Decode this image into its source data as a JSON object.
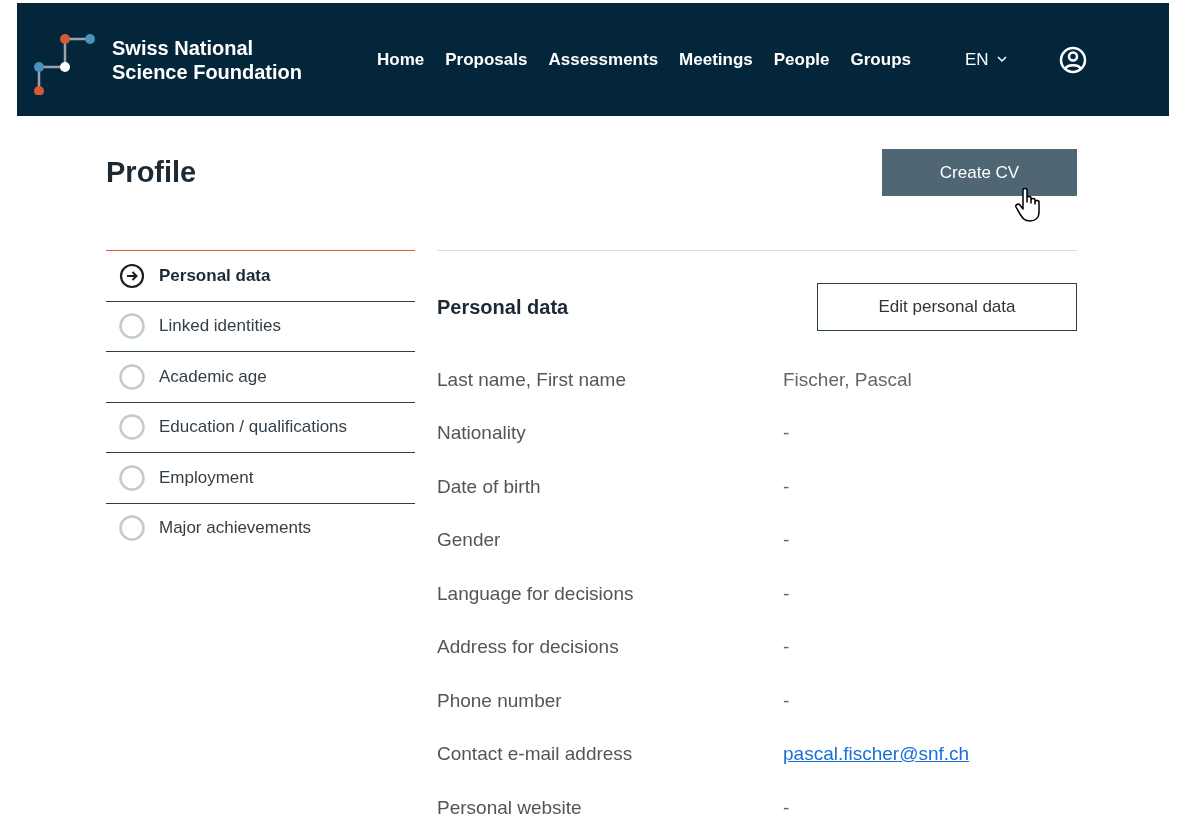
{
  "header": {
    "logo_text": [
      "Swiss National",
      "Science Foundation"
    ],
    "nav": [
      "Home",
      "Proposals",
      "Assessments",
      "Meetings",
      "People",
      "Groups"
    ],
    "language": "EN"
  },
  "page_title": "Profile",
  "create_cv_button": "Create CV",
  "sections": [
    {
      "label": "Personal data",
      "selected": true
    },
    {
      "label": "Linked identities",
      "selected": false
    },
    {
      "label": "Academic age",
      "selected": false
    },
    {
      "label": "Education / qualifications",
      "selected": false
    },
    {
      "label": "Employment",
      "selected": false
    },
    {
      "label": "Major achievements",
      "selected": false
    }
  ],
  "panel": {
    "title": "Personal data",
    "edit_button": "Edit personal data",
    "fields": [
      {
        "label": "Last name, First name",
        "value": "Fischer, Pascal",
        "kind": "text"
      },
      {
        "label": "Nationality",
        "value": "-",
        "kind": "text"
      },
      {
        "label": "Date of birth",
        "value": "-",
        "kind": "text"
      },
      {
        "label": "Gender",
        "value": "-",
        "kind": "text"
      },
      {
        "label": "Language for decisions",
        "value": "-",
        "kind": "text"
      },
      {
        "label": "Address for decisions",
        "value": "-",
        "kind": "text"
      },
      {
        "label": "Phone number",
        "value": "-",
        "kind": "text"
      },
      {
        "label": "Contact e-mail address",
        "value": "pascal.fischer@snf.ch",
        "kind": "link"
      },
      {
        "label": "Personal website",
        "value": "-",
        "kind": "text"
      }
    ]
  }
}
